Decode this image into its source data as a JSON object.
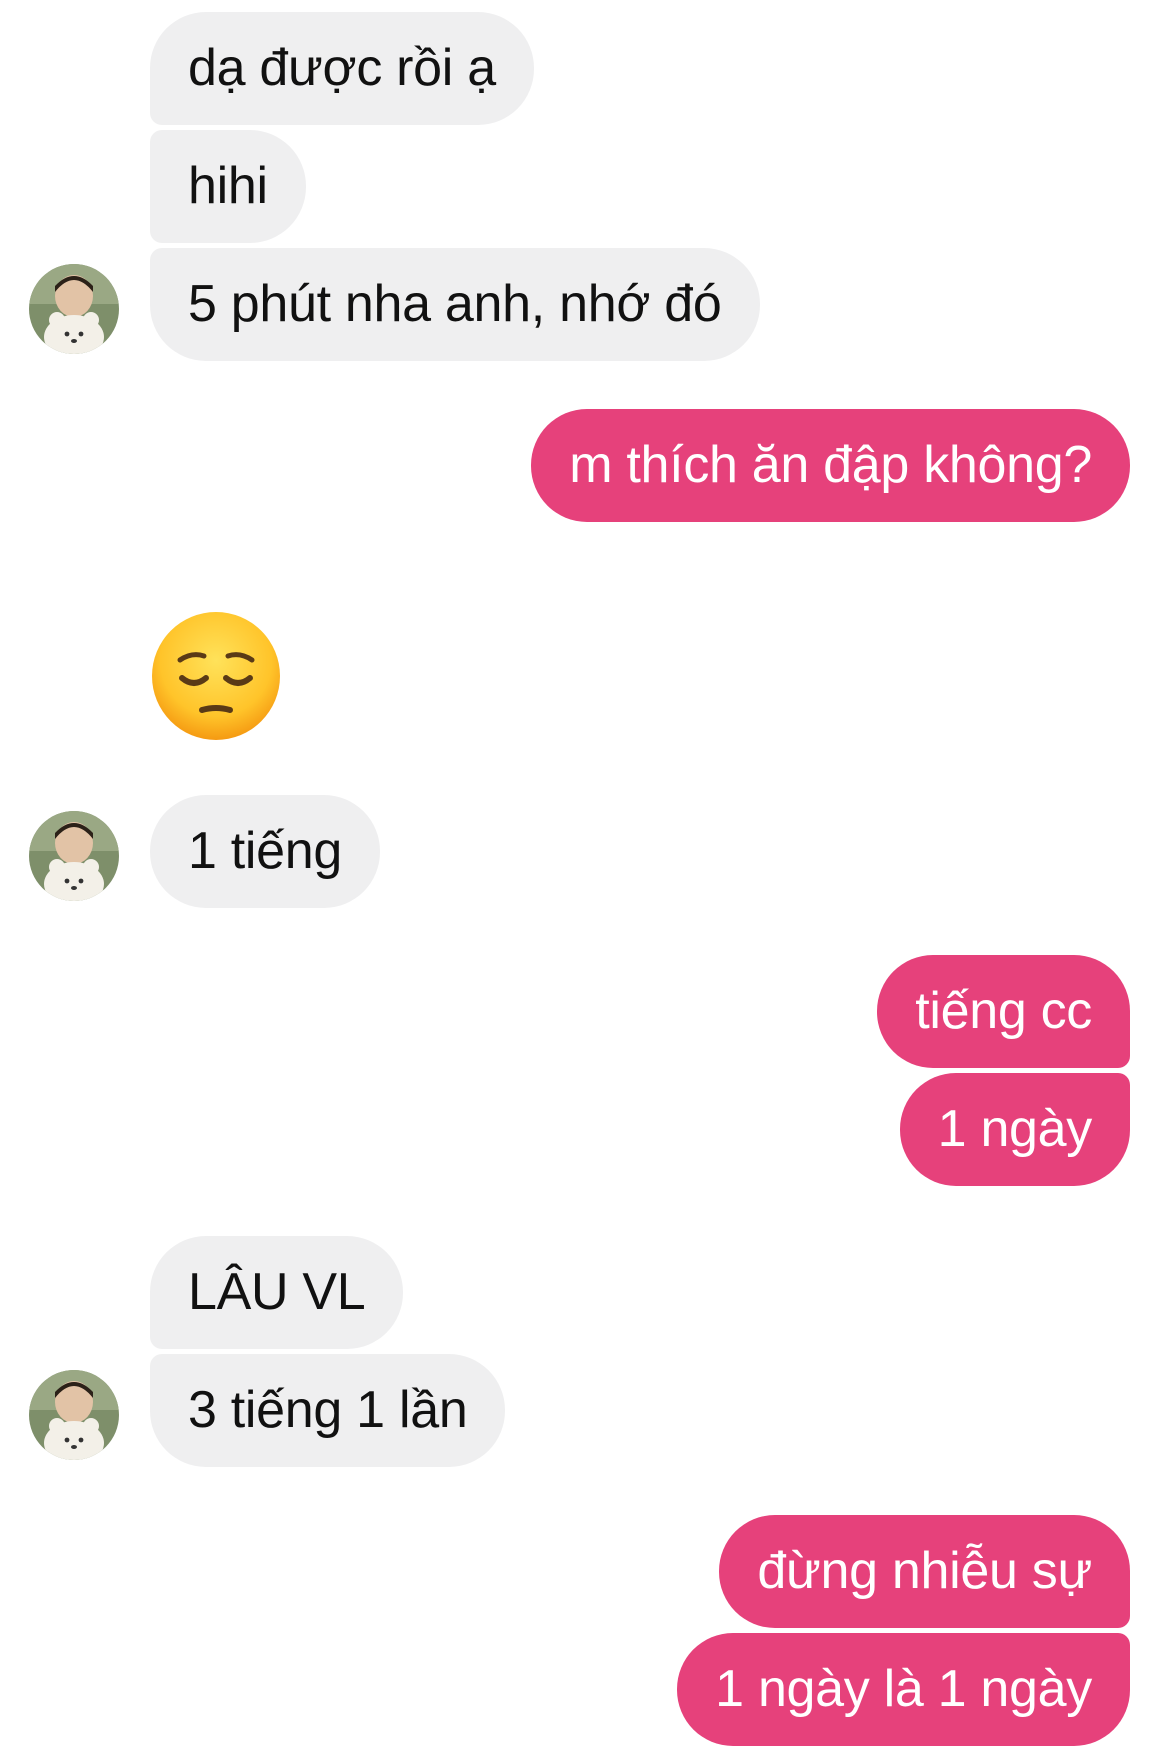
{
  "colors": {
    "incoming_bubble": "#efeff0",
    "outgoing_bubble": "#e6417b",
    "incoming_text": "#111111",
    "outgoing_text": "#ffffff"
  },
  "messages": [
    {
      "sender": "contact",
      "text": "dạ được rồi ạ"
    },
    {
      "sender": "contact",
      "text": "hihi"
    },
    {
      "sender": "contact",
      "text": "5 phút nha anh, nhớ đó"
    },
    {
      "sender": "me",
      "text": "m thích ăn đập không?"
    },
    {
      "sender": "contact",
      "emoji": "pensive-face",
      "text": "😔"
    },
    {
      "sender": "contact",
      "text": "1 tiếng"
    },
    {
      "sender": "me",
      "text": "tiếng cc"
    },
    {
      "sender": "me",
      "text": "1 ngày"
    },
    {
      "sender": "contact",
      "text": "LÂU VL"
    },
    {
      "sender": "contact",
      "text": "3 tiếng 1 lần"
    },
    {
      "sender": "me",
      "text": "đừng nhiễu sự"
    },
    {
      "sender": "me",
      "text": "1 ngày là 1 ngày"
    }
  ],
  "contact_avatar": {
    "icon": "contact-avatar-photo"
  }
}
